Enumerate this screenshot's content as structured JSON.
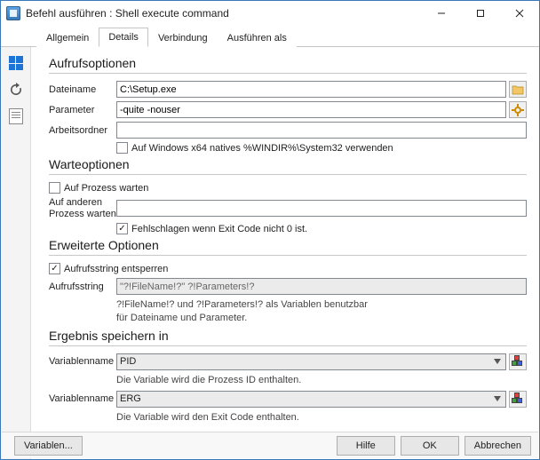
{
  "window": {
    "title": "Befehl ausführen : Shell execute command"
  },
  "tabs": {
    "t0": "Allgemein",
    "t1": "Details",
    "t2": "Verbindung",
    "t3": "Ausführen als",
    "activeIndex": 1
  },
  "sections": {
    "callopts": {
      "title": "Aufrufsoptionen",
      "filename_label": "Dateiname",
      "filename_value": "C:\\Setup.exe",
      "param_label": "Parameter",
      "param_value": "-quite -nouser",
      "workdir_label": "Arbeitsordner",
      "workdir_value": "",
      "x64_label": "Auf Windows x64 natives %WINDIR%\\System32 verwenden"
    },
    "waitopts": {
      "title": "Warteoptionen",
      "wait_label": "Auf Prozess warten",
      "waitother_label_l1": "Auf anderen",
      "waitother_label_l2": "Prozess warten",
      "waitother_value": "",
      "exitfail_label": "Fehlschlagen wenn Exit Code nicht 0 ist."
    },
    "extopts": {
      "title": "Erweiterte Optionen",
      "unlock_label": "Aufrufsstring entsperren",
      "callstr_label": "Aufrufsstring",
      "callstr_value": "\"?!FileName!?\" ?!Parameters!?",
      "note_l1": "?!FileName!? und ?!Parameters!? als Variablen benutzbar",
      "note_l2": "für Dateiname und Parameter."
    },
    "result": {
      "title": "Ergebnis speichern in",
      "var1_label": "Variablenname",
      "var1_value": "PID",
      "var1_note": "Die Variable wird die Prozess ID enthalten.",
      "var2_label": "Variablenname",
      "var2_value": "ERG",
      "var2_note": "Die Variable wird den Exit Code enthalten."
    }
  },
  "footer": {
    "vars": "Variablen...",
    "help": "Hilfe",
    "ok": "OK",
    "cancel": "Abbrechen"
  }
}
